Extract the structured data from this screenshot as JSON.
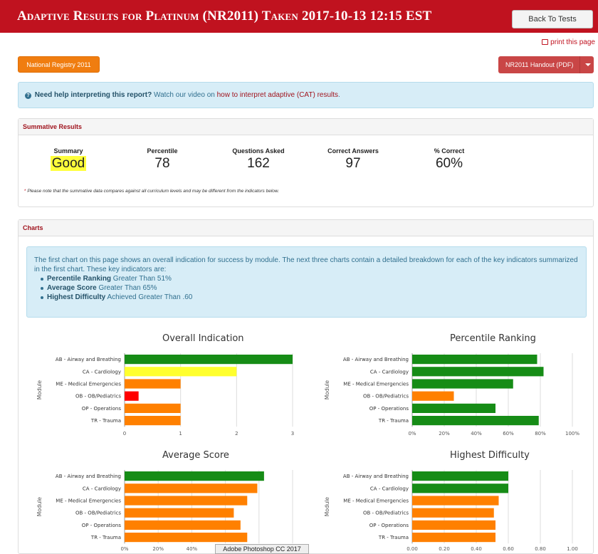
{
  "header": {
    "title": "Adaptive Results for Platinum (NR2011) Taken 2017-10-13 12:15 EST",
    "back_label": "Back To Tests"
  },
  "print_label": "print this page",
  "curriculum_button": "National Registry 2011",
  "handout_button": "NR2011 Handout (PDF)",
  "help": {
    "bold": "Need help interpreting this report?",
    "text": " Watch our video on ",
    "link": "how to interpret adaptive (CAT) results",
    "end": "."
  },
  "summative": {
    "heading": "Summative Results",
    "stats": [
      {
        "label": "Summary",
        "value": "Good"
      },
      {
        "label": "Percentile",
        "value": "78"
      },
      {
        "label": "Questions Asked",
        "value": "162"
      },
      {
        "label": "Correct Answers",
        "value": "97"
      },
      {
        "label": "% Correct",
        "value": "60%"
      }
    ],
    "note_star": "*",
    "note": " Please note that the summative data compares against all curriculum levels and may be different from the indicators below."
  },
  "charts_panel": {
    "heading": "Charts",
    "intro": "The first chart on this page shows an overall indication for success by module. The next three charts contain a detailed breakdown for each of the key indicators summarized in the first chart. These key indicators are:",
    "indicators": [
      {
        "bold": "Percentile Ranking",
        "text": " Greater Than 51%"
      },
      {
        "bold": "Average Score",
        "text": " Greater Than 65%"
      },
      {
        "bold": "Highest Difficulty",
        "text": " Achieved Greater Than .60"
      }
    ]
  },
  "colors": {
    "green": "#168c16",
    "yellow": "#ffff2e",
    "orange": "#ff8000",
    "red": "#ff0000"
  },
  "chart_data": [
    {
      "type": "bar",
      "title": "Overall Indication",
      "ylabel": "Module",
      "categories": [
        "AB - Airway and Breathing",
        "CA - Cardiology",
        "ME - Medical Emergencies",
        "OB - OB/Pediatrics",
        "OP - Operations",
        "TR - Trauma"
      ],
      "values": [
        3,
        2,
        1,
        0.25,
        1,
        1
      ],
      "colors": [
        "green",
        "yellow",
        "orange",
        "red",
        "orange",
        "orange"
      ],
      "xlim": [
        0,
        3
      ],
      "ticks": [
        "0",
        "1",
        "2",
        "3"
      ]
    },
    {
      "type": "bar",
      "title": "Percentile Ranking",
      "ylabel": "Module",
      "categories": [
        "AB - Airway and Breathing",
        "CA - Cardiology",
        "ME - Medical Emergencies",
        "OB - OB/Pediatrics",
        "OP - Operations",
        "TR - Trauma"
      ],
      "values": [
        78,
        82,
        63,
        26,
        52,
        79
      ],
      "colors": [
        "green",
        "green",
        "green",
        "orange",
        "green",
        "green"
      ],
      "xlim": [
        0,
        100
      ],
      "ticks": [
        "0%",
        "20%",
        "40%",
        "60%",
        "80%",
        "100%"
      ]
    },
    {
      "type": "bar",
      "title": "Average Score",
      "ylabel": "Module",
      "categories": [
        "AB - Airway and Breathing",
        "CA - Cardiology",
        "ME - Medical Emergencies",
        "OB - OB/Pediatrics",
        "OP - Operations",
        "TR - Trauma"
      ],
      "values": [
        83,
        79,
        73,
        65,
        69,
        73
      ],
      "colors": [
        "green",
        "orange",
        "orange",
        "orange",
        "orange",
        "orange"
      ],
      "xlim": [
        0,
        100
      ],
      "ticks": [
        "0%",
        "20%",
        "40%",
        "60%",
        "80%",
        "100%"
      ]
    },
    {
      "type": "bar",
      "title": "Highest Difficulty",
      "ylabel": "Module",
      "categories": [
        "AB - Airway and Breathing",
        "CA - Cardiology",
        "ME - Medical Emergencies",
        "OB - OB/Pediatrics",
        "OP - Operations",
        "TR - Trauma"
      ],
      "values": [
        0.6,
        0.6,
        0.54,
        0.51,
        0.52,
        0.52
      ],
      "colors": [
        "green",
        "green",
        "orange",
        "orange",
        "orange",
        "orange"
      ],
      "xlim": [
        0,
        1
      ],
      "ticks": [
        "0.00",
        "0.20",
        "0.40",
        "0.60",
        "0.80",
        "1.00"
      ]
    }
  ],
  "tooltip": "Adobe Photoshop CC 2017"
}
